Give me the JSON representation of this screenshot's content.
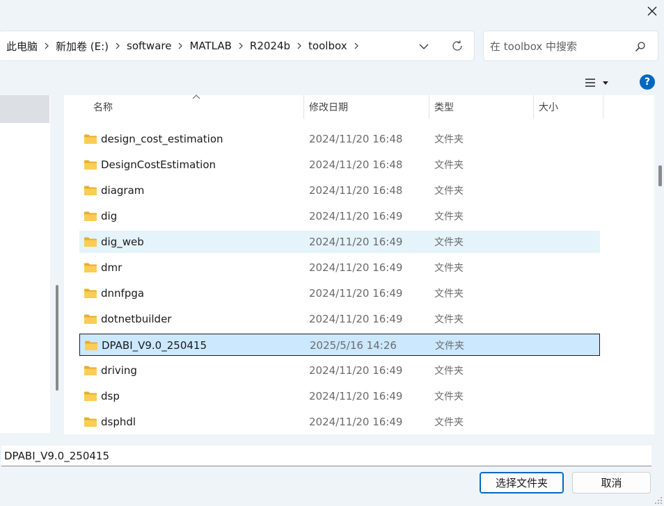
{
  "window": {
    "close_icon": "close-icon"
  },
  "breadcrumb": {
    "items": [
      "此电脑",
      "新加卷 (E:)",
      "software",
      "MATLAB",
      "R2024b",
      "toolbox"
    ]
  },
  "search": {
    "placeholder": "在 toolbox 中搜索"
  },
  "toolbar": {
    "help_label": "?"
  },
  "columns": {
    "name": "名称",
    "date": "修改日期",
    "type": "类型",
    "size": "大小"
  },
  "files": [
    {
      "name": "design_cost_estimation",
      "date": "2024/11/20 16:48",
      "type": "文件夹"
    },
    {
      "name": "DesignCostEstimation",
      "date": "2024/11/20 16:48",
      "type": "文件夹"
    },
    {
      "name": "diagram",
      "date": "2024/11/20 16:48",
      "type": "文件夹"
    },
    {
      "name": "dig",
      "date": "2024/11/20 16:49",
      "type": "文件夹"
    },
    {
      "name": "dig_web",
      "date": "2024/11/20 16:49",
      "type": "文件夹",
      "state": "hover"
    },
    {
      "name": "dmr",
      "date": "2024/11/20 16:49",
      "type": "文件夹"
    },
    {
      "name": "dnnfpga",
      "date": "2024/11/20 16:49",
      "type": "文件夹"
    },
    {
      "name": "dotnetbuilder",
      "date": "2024/11/20 16:49",
      "type": "文件夹"
    },
    {
      "name": "DPABI_V9.0_250415",
      "date": "2025/5/16 14:26",
      "type": "文件夹",
      "state": "selected"
    },
    {
      "name": "driving",
      "date": "2024/11/20 16:49",
      "type": "文件夹"
    },
    {
      "name": "dsp",
      "date": "2024/11/20 16:49",
      "type": "文件夹"
    },
    {
      "name": "dsphdl",
      "date": "2024/11/20 16:49",
      "type": "文件夹"
    }
  ],
  "filename": {
    "value": "DPABI_V9.0_250415"
  },
  "buttons": {
    "ok": "选择文件夹",
    "cancel": "取消"
  },
  "colors": {
    "accent": "#0067c0",
    "folder": "#f8c64a",
    "selected_bg": "#cce8ff",
    "hover_bg": "#e5f3fb"
  }
}
